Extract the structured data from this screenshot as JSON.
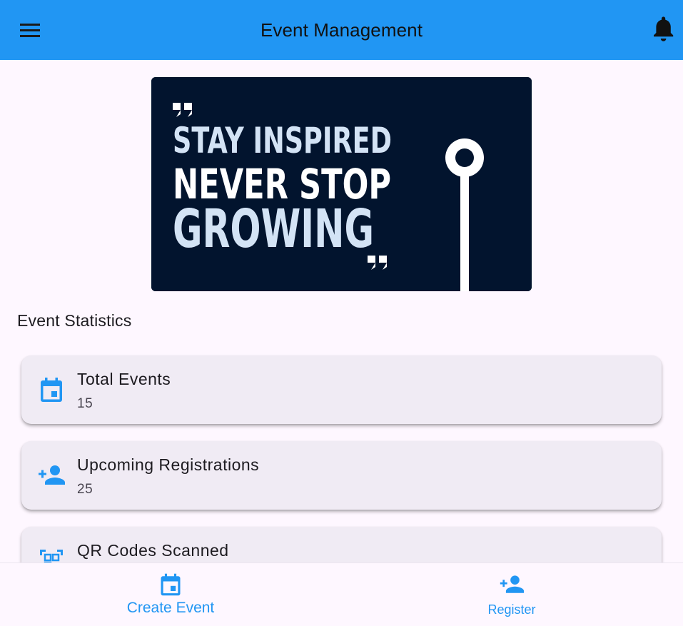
{
  "app_bar": {
    "title": "Event Management",
    "menu_icon": "menu-icon",
    "notification_icon": "bell-icon"
  },
  "banner": {
    "line1": "STAY INSPIRED",
    "line2": "NEVER STOP",
    "line3": "GROWING",
    "colors": {
      "background": "#02142e",
      "accent_text": "#d3e3f5",
      "white_text": "#ffffff"
    }
  },
  "statistics": {
    "title": "Event Statistics",
    "cards": [
      {
        "label": "Total Events",
        "value": "15",
        "icon": "calendar-icon"
      },
      {
        "label": "Upcoming Registrations",
        "value": "25",
        "icon": "person-add-icon"
      },
      {
        "label": "QR Codes Scanned",
        "value": "",
        "icon": "qr-scan-icon"
      }
    ]
  },
  "bottom_nav": {
    "items": [
      {
        "label": "Create Event",
        "icon": "calendar-icon"
      },
      {
        "label": "Register",
        "icon": "person-add-icon"
      }
    ]
  },
  "colors": {
    "primary": "#2196f3",
    "background": "#fef7ff",
    "card": "#f0ebf4"
  }
}
